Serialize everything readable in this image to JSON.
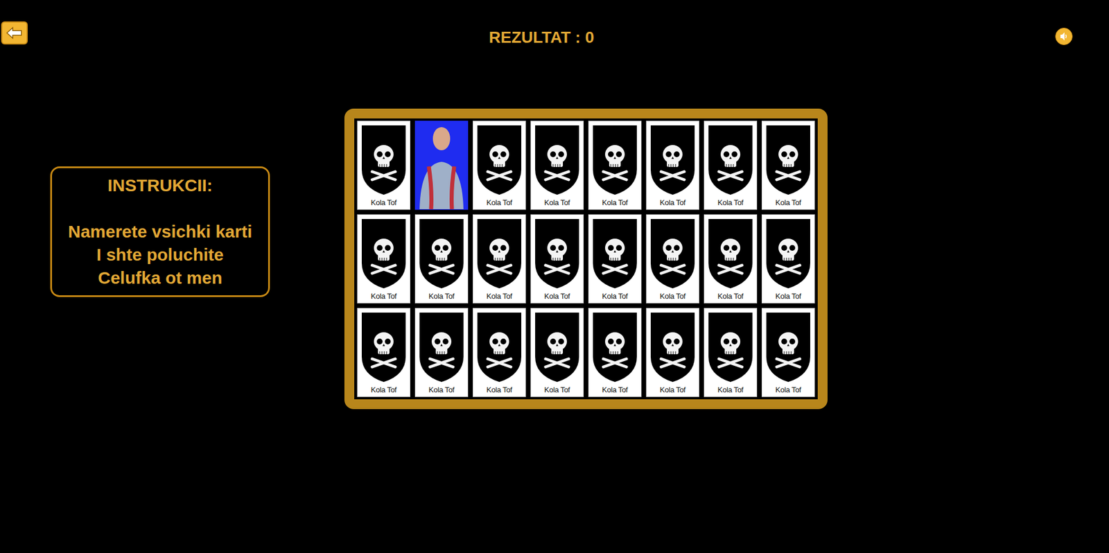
{
  "header": {
    "back": "back",
    "score": "REZULTAT : 0"
  },
  "instructions": {
    "title": "INSTRUKCII:",
    "lines": [
      "Namerete vsichki karti",
      "I shte poluchite",
      "Celufka ot men"
    ]
  },
  "cards": [
    {
      "label": "Kola Tof",
      "face_up": false
    },
    {
      "label": "",
      "face_up": true
    },
    {
      "label": "Kola Tof",
      "face_up": false
    },
    {
      "label": "Kola Tof",
      "face_up": false
    },
    {
      "label": "Kola Tof",
      "face_up": false
    },
    {
      "label": "Kola Tof",
      "face_up": false
    },
    {
      "label": "Kola Tof",
      "face_up": false
    },
    {
      "label": "Kola Tof",
      "face_up": false
    },
    {
      "label": "Kola Tof",
      "face_up": false
    },
    {
      "label": "Kola Tof",
      "face_up": false
    },
    {
      "label": "Kola Tof",
      "face_up": false
    },
    {
      "label": "Kola Tof",
      "face_up": false
    },
    {
      "label": "Kola Tof",
      "face_up": false
    },
    {
      "label": "Kola Tof",
      "face_up": false
    },
    {
      "label": "Kola Tof",
      "face_up": false
    },
    {
      "label": "Kola Tof",
      "face_up": false
    },
    {
      "label": "Kola Tof",
      "face_up": false
    },
    {
      "label": "Kola Tof",
      "face_up": false
    },
    {
      "label": "Kola Tof",
      "face_up": false
    },
    {
      "label": "Kola Tof",
      "face_up": false
    },
    {
      "label": "Kola Tof",
      "face_up": false
    },
    {
      "label": "Kola Tof",
      "face_up": false
    },
    {
      "label": "Kola Tof",
      "face_up": false
    },
    {
      "label": "Kola Tof",
      "face_up": false
    }
  ]
}
